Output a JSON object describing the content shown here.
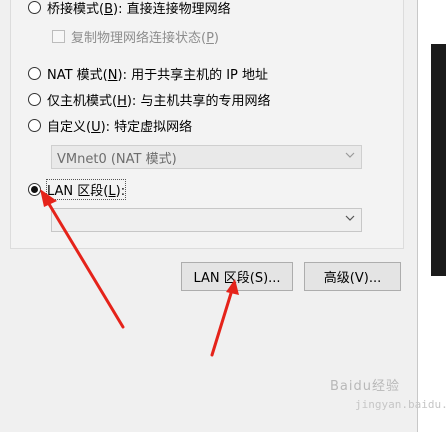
{
  "network_options": {
    "bridged": {
      "label_pre": "桥接模式(",
      "key": "B",
      "label_post": "): 直接连接物理网络"
    },
    "replicate_state": {
      "label_pre": "复制物理网络连接状态(",
      "key": "P",
      "label_post": ")"
    },
    "nat": {
      "label_pre": "NAT 模式(",
      "key": "N",
      "label_post": "): 用于共享主机的 IP 地址"
    },
    "host_only": {
      "label_pre": "仅主机模式(",
      "key": "H",
      "label_post": "): 与主机共享的专用网络"
    },
    "custom": {
      "label_pre": "自定义(",
      "key": "U",
      "label_post": "): 特定虚拟网络"
    },
    "custom_select_value": "VMnet0 (NAT 模式)",
    "lan_segment": {
      "label_pre": "LAN 区段(",
      "key": "L",
      "label_post": "):"
    },
    "lan_select_value": "",
    "selected": "lan_segment"
  },
  "buttons": {
    "lan_segments": "LAN 区段(S)...",
    "advanced": "高级(V)..."
  },
  "annotation": {
    "arrow_color": "#e5231a",
    "watermark": "Baidu经验",
    "watermark_url": "jingyan.baidu.com"
  },
  "icons": [
    "radio-button",
    "checkbox",
    "chevron-down-icon",
    "red-arrow"
  ]
}
